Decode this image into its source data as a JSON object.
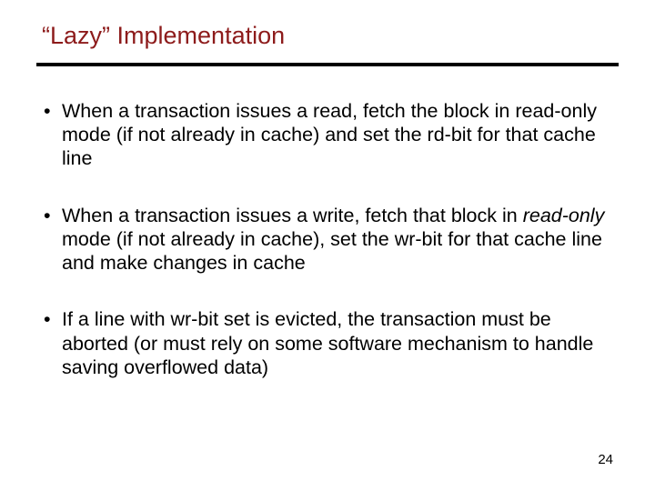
{
  "title": "“Lazy” Implementation",
  "bullets": [
    {
      "pre": "When a transaction issues a read, fetch the block in read-only mode (if not already in cache) and set the rd-bit for that cache line",
      "em": "",
      "post": ""
    },
    {
      "pre": "When a transaction issues a write, fetch that block in ",
      "em": "read-only",
      "post": " mode (if not already in cache), set the wr-bit for that cache line and make changes in cache"
    },
    {
      "pre": "If a line with wr-bit set is evicted, the transaction must be aborted (or must rely on some software mechanism to handle saving overflowed data)",
      "em": "",
      "post": ""
    }
  ],
  "page_number": "24"
}
